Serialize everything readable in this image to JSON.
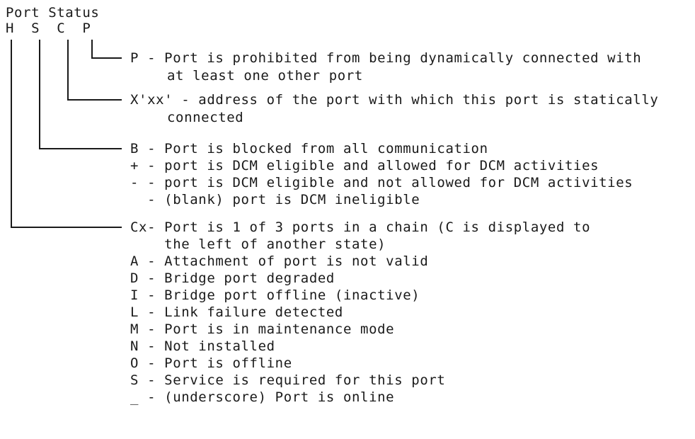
{
  "header": {
    "title": "Port Status",
    "columns": "H  S  C  P"
  },
  "legend": {
    "p_desc": "P - Port is prohibited from being dynamically connected with",
    "p_desc_cont": "at least one other port",
    "c_desc": "X'xx' - address of the port with which this port is statically",
    "c_desc_cont": "connected",
    "s_items": [
      "B - Port is blocked from all communication",
      "+ - port is DCM eligible and allowed for DCM activities",
      "- - port is DCM eligible and not allowed for DCM activities",
      "  - (blank) port is DCM ineligible"
    ],
    "h_items": [
      "Cx- Port is 1 of 3 ports in a chain (C is displayed to",
      "    the left of another state)",
      "A - Attachment of port is not valid",
      "D - Bridge port degraded",
      "I - Bridge port offline (inactive)",
      "L - Link failure detected",
      "M - Port is in maintenance mode",
      "N - Not installed",
      "O - Port is offline",
      "S - Service is required for this port",
      "_ - (underscore) Port is online"
    ]
  }
}
